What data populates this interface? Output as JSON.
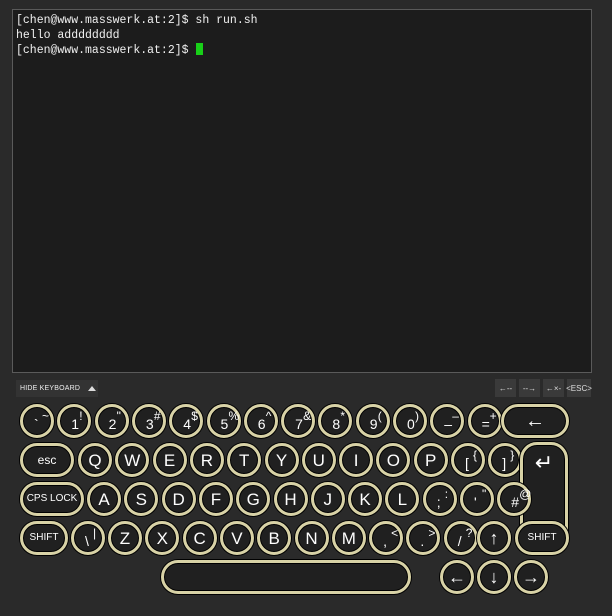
{
  "terminal": {
    "lines": [
      "[chen@www.masswerk.at:2]$ sh run.sh",
      "hello adddddddd",
      "[chen@www.masswerk.at:2]$ "
    ]
  },
  "toolbar": {
    "hide_keyboard": "HIDE KEYBOARD",
    "aux_keys": [
      "←--",
      "--→",
      "←×-",
      "<ESC>"
    ]
  },
  "keyboard": {
    "row1": [
      {
        "lo": "`",
        "hi": "~"
      },
      {
        "lo": "1",
        "hi": "!"
      },
      {
        "lo": "2",
        "hi": "\""
      },
      {
        "lo": "3",
        "hi": "#"
      },
      {
        "lo": "4",
        "hi": "$"
      },
      {
        "lo": "5",
        "hi": "%"
      },
      {
        "lo": "6",
        "hi": "^"
      },
      {
        "lo": "7",
        "hi": "&"
      },
      {
        "lo": "8",
        "hi": "*"
      },
      {
        "lo": "9",
        "hi": "("
      },
      {
        "lo": "0",
        "hi": ")"
      },
      {
        "lo": "–",
        "hi": "–"
      },
      {
        "lo": "=",
        "hi": "+"
      }
    ],
    "backspace": "←",
    "esc": "esc",
    "row2": [
      "Q",
      "W",
      "E",
      "R",
      "T",
      "Y",
      "U",
      "I",
      "O",
      "P"
    ],
    "row2_extra": [
      {
        "lo": "[",
        "hi": "{"
      },
      {
        "lo": "]",
        "hi": "}"
      }
    ],
    "enter": "↵",
    "caps": "CPS LOCK",
    "row3": [
      "A",
      "S",
      "D",
      "F",
      "G",
      "H",
      "J",
      "K",
      "L"
    ],
    "row3_extra": [
      {
        "lo": ";",
        "hi": ":"
      },
      {
        "lo": "'",
        "hi": "\""
      },
      {
        "lo": "#",
        "hi": "@"
      }
    ],
    "shift": "SHIFT",
    "row4_first": {
      "lo": "\\",
      "hi": "|"
    },
    "row4": [
      "Z",
      "X",
      "C",
      "V",
      "B",
      "N",
      "M"
    ],
    "row4_extra": [
      {
        "lo": ",",
        "hi": "<"
      },
      {
        "lo": ".",
        "hi": ">"
      },
      {
        "lo": "/",
        "hi": "?"
      }
    ],
    "up": "↑",
    "left": "←",
    "down": "↓",
    "right": "→"
  }
}
